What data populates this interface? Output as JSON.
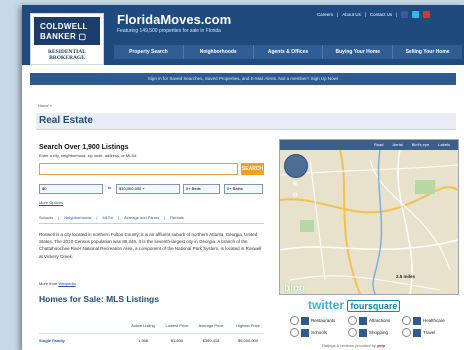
{
  "header": {
    "logo_line1": "COLDWELL",
    "logo_line2": "BANKER ▢",
    "logo_sub": "RESIDENTIAL BROKERAGE",
    "site_title": "FloridaMoves.com",
    "tagline": "Featuring 149,500 properties for sale in Florida",
    "top_links": [
      "Careers",
      "About Us",
      "Contact Us"
    ],
    "nav": [
      "Property Search",
      "Neighborhoods",
      "Agents & Offices",
      "Buying Your Home",
      "Selling Your Home"
    ]
  },
  "signin_bar": "Sign in for Saved Searches, Saved Properties, and E-Mail Alerts. Not a member? Sign Up Now!",
  "breadcrumb": "Home »",
  "page_title": "Real Estate",
  "search": {
    "heading": "Search Over 1,900 Listings",
    "subtext": "Enter a city, neighborhood, zip code, address, or MLS#",
    "input_value": "",
    "button": "SEARCH",
    "price_min": "$0",
    "to_label": "to",
    "price_max": "$10,000,000 +",
    "beds": "0+ Beds",
    "baths": "0+ Baths",
    "more_options": "More Options"
  },
  "tabs": [
    "Schools",
    "Neighborhoods",
    "MLS#",
    "Acreage and Farms",
    "Rentals"
  ],
  "description": "Roswell is a city located in northern Fulton County; it is an affluent suburb of northern Atlanta, Georgia, United States. The 2010 Census population was 88,346. It is the seventh-largest city in Georgia. A branch of the Chattahoochee River National Recreation Area, a component of the National Park System, is located in Roswell at Vickery Creek.",
  "wiki": {
    "prefix": "More from",
    "link": "Wikipedia"
  },
  "sale_heading": "Homes for Sale: MLS Listings",
  "table": {
    "headers": [
      "Active Listing",
      "Lowest Price",
      "Average Price",
      "Highest Price"
    ],
    "row_label": "Single Family",
    "row": [
      "1,398",
      "$1,600",
      "$399,418",
      "$9,000,000"
    ]
  },
  "map": {
    "tabs": [
      "Road",
      "Aerial",
      "Bird's eye",
      "Labels"
    ],
    "scale": "2.5 miles",
    "brand": "bing"
  },
  "social": {
    "twitter": "twitter",
    "foursquare": "foursquare"
  },
  "filters": [
    "Restaurants",
    "Attractions",
    "Healthcare",
    "Schools",
    "Shopping",
    "Travel"
  ],
  "ratings": {
    "prefix": "Ratings & reviews provided by",
    "brand": "yelp"
  },
  "colors": {
    "brand_navy": "#1f4a7e",
    "accent_orange": "#f4a21e",
    "link_blue": "#2355a3"
  }
}
